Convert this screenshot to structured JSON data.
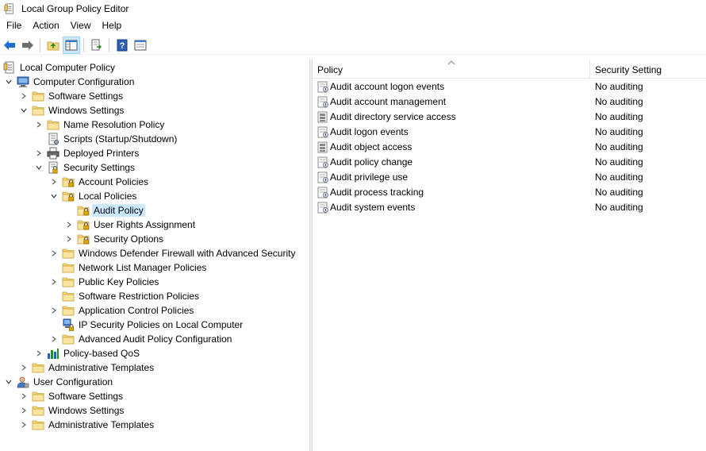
{
  "window": {
    "title": "Local Group Policy Editor"
  },
  "menu": [
    "File",
    "Action",
    "View",
    "Help"
  ],
  "toolbar": [
    {
      "name": "back-button",
      "icon": "back-arrow-icon"
    },
    {
      "name": "forward-button",
      "icon": "forward-arrow-icon"
    },
    {
      "name": "up-one-level-button",
      "icon": "folder-up-icon"
    },
    {
      "name": "show-hide-console-tree-button",
      "icon": "console-tree-icon"
    },
    {
      "name": "export-list-button",
      "icon": "export-list-icon"
    },
    {
      "name": "help-button",
      "icon": "help-icon"
    },
    {
      "name": "properties-button",
      "icon": "properties-icon"
    }
  ],
  "tree": [
    {
      "label": "Local Computer Policy",
      "level": 0,
      "icon": "policy-doc-icon",
      "expander": "none"
    },
    {
      "label": "Computer Configuration",
      "level": 1,
      "icon": "computer-icon",
      "expander": "expanded"
    },
    {
      "label": "Software Settings",
      "level": 2,
      "icon": "folder-icon",
      "expander": "collapsed"
    },
    {
      "label": "Windows Settings",
      "level": 2,
      "icon": "folder-icon",
      "expander": "expanded"
    },
    {
      "label": "Name Resolution Policy",
      "level": 3,
      "icon": "folder-icon",
      "expander": "collapsed"
    },
    {
      "label": "Scripts (Startup/Shutdown)",
      "level": 3,
      "icon": "scripts-icon",
      "expander": "none"
    },
    {
      "label": "Deployed Printers",
      "level": 3,
      "icon": "printer-icon",
      "expander": "collapsed"
    },
    {
      "label": "Security Settings",
      "level": 3,
      "icon": "security-settings-icon",
      "expander": "expanded"
    },
    {
      "label": "Account Policies",
      "level": 4,
      "icon": "locked-folder-icon",
      "expander": "collapsed"
    },
    {
      "label": "Local Policies",
      "level": 4,
      "icon": "locked-folder-icon",
      "expander": "expanded"
    },
    {
      "label": "Audit Policy",
      "level": 5,
      "icon": "locked-folder-icon",
      "expander": "none",
      "selected": true
    },
    {
      "label": "User Rights Assignment",
      "level": 5,
      "icon": "locked-folder-icon",
      "expander": "collapsed"
    },
    {
      "label": "Security Options",
      "level": 5,
      "icon": "locked-folder-icon",
      "expander": "collapsed"
    },
    {
      "label": "Windows Defender Firewall with Advanced Security",
      "level": 4,
      "icon": "folder-icon",
      "expander": "collapsed"
    },
    {
      "label": "Network List Manager Policies",
      "level": 4,
      "icon": "folder-icon",
      "expander": "none"
    },
    {
      "label": "Public Key Policies",
      "level": 4,
      "icon": "folder-icon",
      "expander": "collapsed"
    },
    {
      "label": "Software Restriction Policies",
      "level": 4,
      "icon": "folder-icon",
      "expander": "none"
    },
    {
      "label": "Application Control Policies",
      "level": 4,
      "icon": "folder-icon",
      "expander": "collapsed"
    },
    {
      "label": "IP Security Policies on Local Computer",
      "level": 4,
      "icon": "ip-security-icon",
      "expander": "none"
    },
    {
      "label": "Advanced Audit Policy Configuration",
      "level": 4,
      "icon": "folder-icon",
      "expander": "collapsed"
    },
    {
      "label": "Policy-based QoS",
      "level": 3,
      "icon": "qos-chart-icon",
      "expander": "collapsed"
    },
    {
      "label": "Administrative Templates",
      "level": 2,
      "icon": "folder-icon",
      "expander": "collapsed"
    },
    {
      "label": "User Configuration",
      "level": 1,
      "icon": "user-icon",
      "expander": "expanded"
    },
    {
      "label": "Software Settings",
      "level": 2,
      "icon": "folder-icon",
      "expander": "collapsed"
    },
    {
      "label": "Windows Settings",
      "level": 2,
      "icon": "folder-icon",
      "expander": "collapsed"
    },
    {
      "label": "Administrative Templates",
      "level": 2,
      "icon": "folder-icon",
      "expander": "collapsed"
    }
  ],
  "list": {
    "columns": {
      "policy": "Policy",
      "setting": "Security Setting"
    },
    "rows": [
      {
        "policy": "Audit account logon events",
        "setting": "No auditing",
        "icon": "policy-item-icon"
      },
      {
        "policy": "Audit account management",
        "setting": "No auditing",
        "icon": "policy-item-icon"
      },
      {
        "policy": "Audit directory service access",
        "setting": "No auditing",
        "icon": "policy-server-icon"
      },
      {
        "policy": "Audit logon events",
        "setting": "No auditing",
        "icon": "policy-item-icon"
      },
      {
        "policy": "Audit object access",
        "setting": "No auditing",
        "icon": "policy-server-icon"
      },
      {
        "policy": "Audit policy change",
        "setting": "No auditing",
        "icon": "policy-item-icon"
      },
      {
        "policy": "Audit privilege use",
        "setting": "No auditing",
        "icon": "policy-item-icon"
      },
      {
        "policy": "Audit process tracking",
        "setting": "No auditing",
        "icon": "policy-item-icon"
      },
      {
        "policy": "Audit system events",
        "setting": "No auditing",
        "icon": "policy-item-icon"
      }
    ]
  },
  "colors": {
    "selection": "#cce8ff",
    "folder": "#f5d67c",
    "arrow_blue": "#1e6fd0"
  }
}
